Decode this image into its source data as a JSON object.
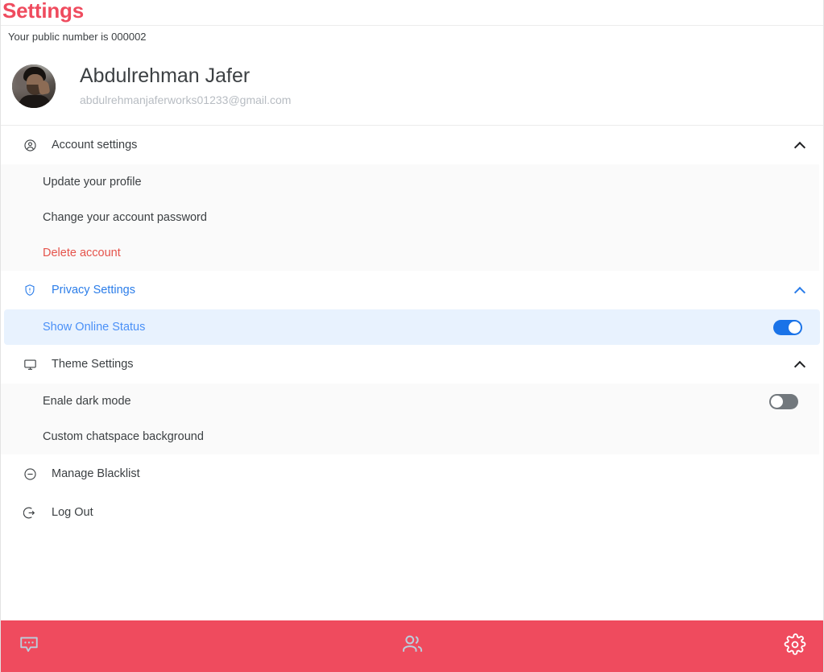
{
  "header": {
    "title": "Settings",
    "public_number_text": "Your public number is 000002",
    "accent_color": "#ef4b5e"
  },
  "profile": {
    "name": "Abdulrehman Jafer",
    "email": "abdulrehmanjaferworks01233@gmail.com",
    "avatar_name": "user-avatar-photo"
  },
  "sections": {
    "account": {
      "label": "Account settings",
      "icon": "user-circle-icon",
      "expanded": true,
      "items": [
        {
          "label": "Update your profile"
        },
        {
          "label": "Change your account password"
        },
        {
          "label": "Delete account"
        }
      ]
    },
    "privacy": {
      "label": "Privacy Settings",
      "icon": "shield-info-icon",
      "expanded": true,
      "accent_color": "#2b7de9",
      "items": [
        {
          "label": "Show Online Status",
          "toggle": "on"
        }
      ]
    },
    "theme": {
      "label": "Theme Settings",
      "icon": "monitor-icon",
      "expanded": true,
      "items": [
        {
          "label": "Enale dark mode",
          "toggle": "off"
        },
        {
          "label": "Custom chatspace background"
        }
      ]
    },
    "blacklist": {
      "label": "Manage Blacklist",
      "icon": "minus-circle-icon"
    },
    "logout": {
      "label": "Log Out",
      "icon": "logout-icon"
    }
  },
  "bottom_nav": {
    "background_color": "#ef4b5e",
    "items": [
      {
        "name": "chats",
        "icon": "chat-bubble-icon",
        "active": false
      },
      {
        "name": "contacts",
        "icon": "users-icon",
        "active": false
      },
      {
        "name": "settings",
        "icon": "gear-icon",
        "active": true
      }
    ]
  }
}
